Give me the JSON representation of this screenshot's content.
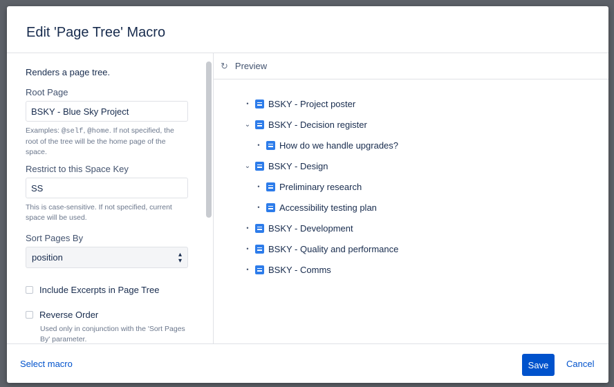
{
  "dialog": {
    "title": "Edit 'Page Tree' Macro"
  },
  "form": {
    "description": "Renders a page tree.",
    "root_page": {
      "label": "Root Page",
      "value": "BSKY - Blue Sky Project",
      "help_prefix": "Examples: ",
      "help_code1": "@self",
      "help_sep": ", ",
      "help_code2": "@home",
      "help_suffix": ". If not specified, the root of the tree will be the home page of the space."
    },
    "space_key": {
      "label": "Restrict to this Space Key",
      "value": "SS",
      "help": "This is case-sensitive. If not specified, current space will be used."
    },
    "sort": {
      "label": "Sort Pages By",
      "value": "position"
    },
    "include_excerpts": {
      "label": "Include Excerpts in Page Tree",
      "checked": false
    },
    "reverse_order": {
      "label": "Reverse Order",
      "checked": false,
      "help": "Used only in conjunction with the 'Sort Pages By' parameter."
    }
  },
  "preview": {
    "label": "Preview",
    "icon": "refresh-icon",
    "tree": [
      {
        "label": "BSKY - Project poster",
        "expanded": false
      },
      {
        "label": "BSKY - Decision register",
        "expanded": true,
        "children": [
          {
            "label": "How do we handle upgrades?"
          }
        ]
      },
      {
        "label": "BSKY - Design",
        "expanded": true,
        "children": [
          {
            "label": "Preliminary research"
          },
          {
            "label": "Accessibility testing plan"
          }
        ]
      },
      {
        "label": "BSKY - Development",
        "expanded": false
      },
      {
        "label": "BSKY - Quality and performance",
        "expanded": false
      },
      {
        "label": "BSKY - Comms",
        "expanded": false
      }
    ]
  },
  "footer": {
    "select_macro": "Select macro",
    "save": "Save",
    "cancel": "Cancel"
  },
  "colors": {
    "primary": "#0052cc",
    "page_icon": "#2d7cea",
    "backdrop": "#5d6168"
  }
}
